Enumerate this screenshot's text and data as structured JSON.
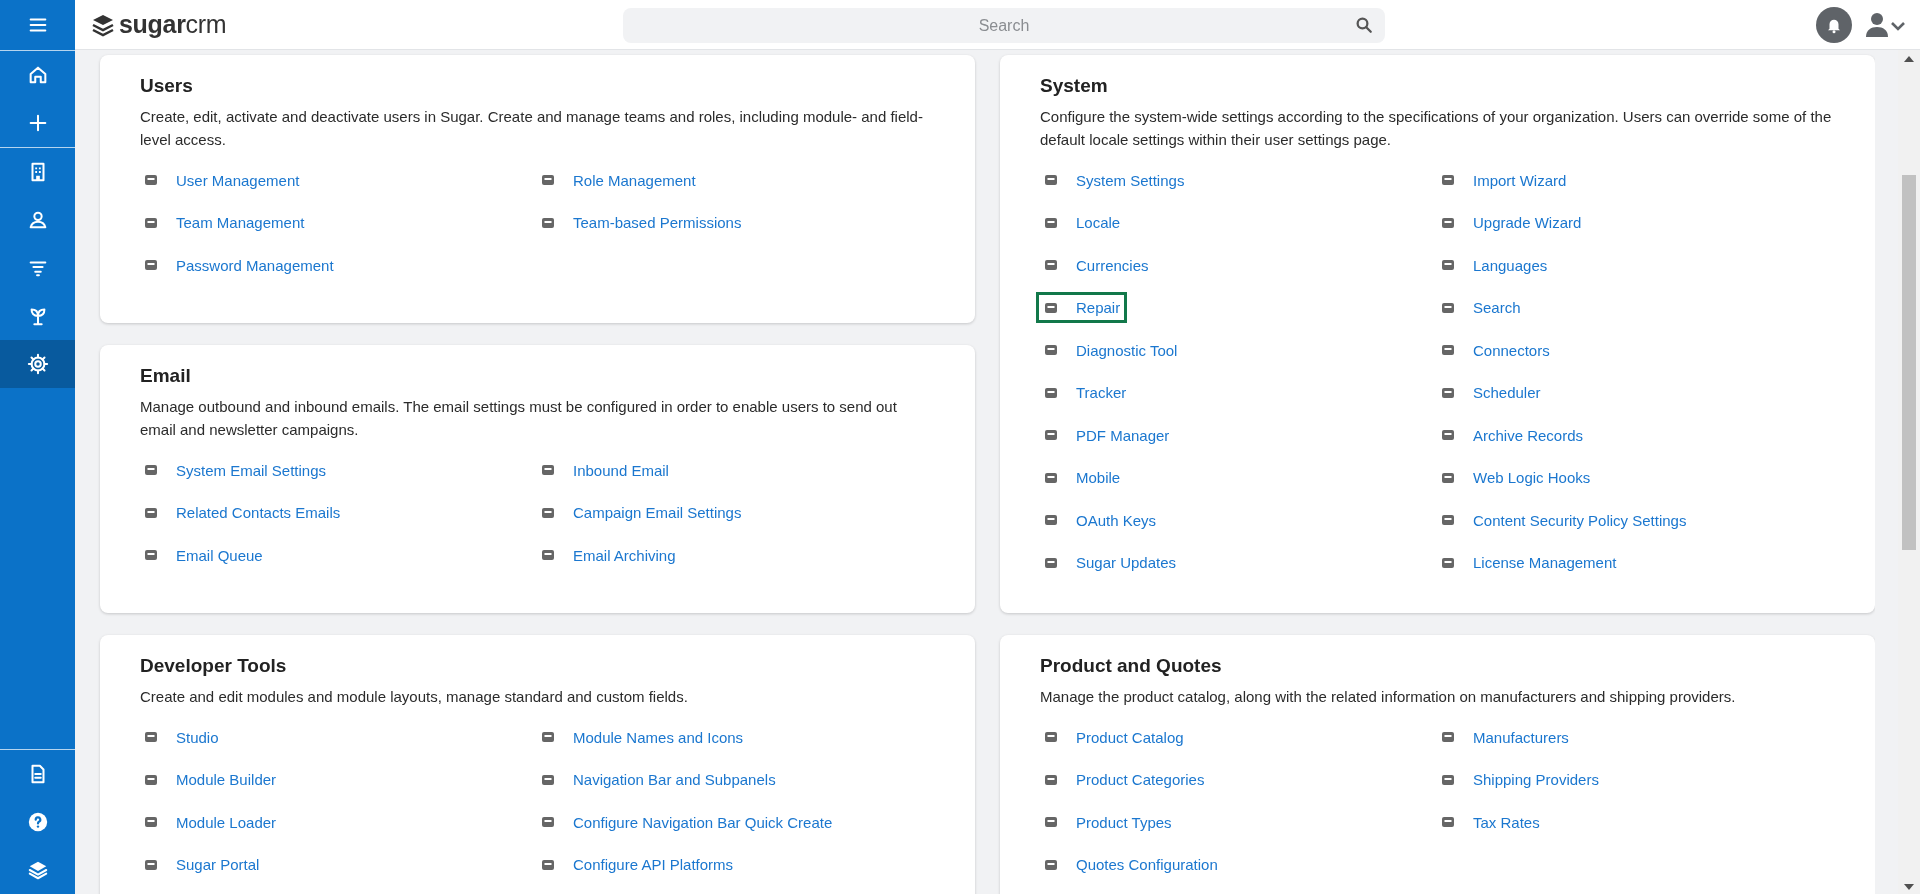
{
  "sidebar": {
    "top": [
      {
        "selected": false
      }
    ],
    "nav": [
      {
        "selected": false
      },
      {
        "selected": false
      }
    ],
    "modules": [
      {
        "selected": false
      },
      {
        "selected": false
      },
      {
        "selected": false
      },
      {
        "selected": false
      },
      {
        "selected": true
      }
    ],
    "bottom": [
      {
        "selected": false
      },
      {
        "selected": false
      },
      {
        "selected": false
      }
    ]
  },
  "header": {
    "logo": "**sugar**crm",
    "search": {
      "placeholder": "Search"
    }
  },
  "columns": [
    {
      "cards": [
        {
          "title": "Users",
          "description": "Create, edit, activate and deactivate users in Sugar. Create and manage teams and roles, including module- and field-level access.",
          "items": [
            {
              "label": "User Management",
              "highlighted": false
            },
            {
              "label": "Role Management",
              "highlighted": false
            },
            {
              "label": "Team Management",
              "highlighted": false
            },
            {
              "label": "Team-based Permissions",
              "highlighted": false
            },
            {
              "label": "Password Management",
              "highlighted": false
            }
          ]
        },
        {
          "title": "Email",
          "description": "Manage outbound and inbound emails. The email settings must be configured in order to enable users to send out email and newsletter campaigns.",
          "items": [
            {
              "label": "System Email Settings",
              "highlighted": false
            },
            {
              "label": "Inbound Email",
              "highlighted": false
            },
            {
              "label": "Related Contacts Emails",
              "highlighted": false
            },
            {
              "label": "Campaign Email Settings",
              "highlighted": false
            },
            {
              "label": "Email Queue",
              "highlighted": false
            },
            {
              "label": "Email Archiving",
              "highlighted": false
            }
          ]
        },
        {
          "title": "Developer Tools",
          "description": "Create and edit modules and module layouts, manage standard and custom fields.",
          "items": [
            {
              "label": "Studio",
              "highlighted": false
            },
            {
              "label": "Module Names and Icons",
              "highlighted": false
            },
            {
              "label": "Module Builder",
              "highlighted": false
            },
            {
              "label": "Navigation Bar and Subpanels",
              "highlighted": false
            },
            {
              "label": "Module Loader",
              "highlighted": false
            },
            {
              "label": "Configure Navigation Bar Quick Create",
              "highlighted": false
            },
            {
              "label": "Sugar Portal",
              "highlighted": false
            },
            {
              "label": "Configure API Platforms",
              "highlighted": false
            }
          ]
        }
      ]
    },
    {
      "cards": [
        {
          "title": "System",
          "description": "Configure the system-wide settings according to the specifications of your organization. Users can override some of the default locale settings within their user settings page.",
          "items": [
            {
              "label": "System Settings",
              "highlighted": false
            },
            {
              "label": "Import Wizard",
              "highlighted": false
            },
            {
              "label": "Locale",
              "highlighted": false
            },
            {
              "label": "Upgrade Wizard",
              "highlighted": false
            },
            {
              "label": "Currencies",
              "highlighted": false
            },
            {
              "label": "Languages",
              "highlighted": false
            },
            {
              "label": "Repair",
              "highlighted": true
            },
            {
              "label": "Search",
              "highlighted": false
            },
            {
              "label": "Diagnostic Tool",
              "highlighted": false
            },
            {
              "label": "Connectors",
              "highlighted": false
            },
            {
              "label": "Tracker",
              "highlighted": false
            },
            {
              "label": "Scheduler",
              "highlighted": false
            },
            {
              "label": "PDF Manager",
              "highlighted": false
            },
            {
              "label": "Archive Records",
              "highlighted": false
            },
            {
              "label": "Mobile",
              "highlighted": false
            },
            {
              "label": "Web Logic Hooks",
              "highlighted": false
            },
            {
              "label": "OAuth Keys",
              "highlighted": false
            },
            {
              "label": "Content Security Policy Settings",
              "highlighted": false
            },
            {
              "label": "Sugar Updates",
              "highlighted": false
            },
            {
              "label": "License Management",
              "highlighted": false
            }
          ]
        },
        {
          "title": "Product and Quotes",
          "description": "Manage the product catalog, along with the related information on manufacturers and shipping providers.",
          "items": [
            {
              "label": "Product Catalog",
              "highlighted": false
            },
            {
              "label": "Manufacturers",
              "highlighted": false
            },
            {
              "label": "Product Categories",
              "highlighted": false
            },
            {
              "label": "Shipping Providers",
              "highlighted": false
            },
            {
              "label": "Product Types",
              "highlighted": false
            },
            {
              "label": "Tax Rates",
              "highlighted": false
            },
            {
              "label": "Quotes Configuration",
              "highlighted": false
            }
          ]
        }
      ]
    }
  ]
}
